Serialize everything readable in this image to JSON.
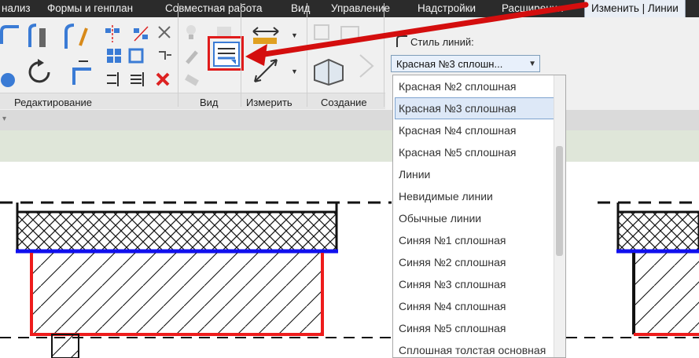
{
  "menu": [
    "нализ",
    "Формы и генплан",
    "Совместная работа",
    "Вид",
    "Управление",
    "Надстройки",
    "Расширения"
  ],
  "active_tab": "Изменить | Линии",
  "panels": {
    "editing": "Редактирование",
    "view": "Вид",
    "measure": "Измерить",
    "create": "Создание"
  },
  "line_style": {
    "label": "Стиль линий:",
    "value": "Красная №3 сплошн..."
  },
  "dropdown_items": [
    "Красная №2 сплошная",
    "Красная №3 сплошная",
    "Красная №4 сплошная",
    "Красная №5 сплошная",
    "Линии",
    "Невидимые линии",
    "Обычные линии",
    "Синяя №1 сплошная",
    "Синяя №2 сплошная",
    "Синяя №3 сплошная",
    "Синяя №4 сплошная",
    "Синяя №5 сплошная",
    "Сплошная толстая основная"
  ],
  "selected_item_index": 1,
  "colors": {
    "highlight": "#e01b1b",
    "blue_line": "#1010ee",
    "red_line": "#ee1c1c",
    "menubar": "#2b2b2b"
  }
}
